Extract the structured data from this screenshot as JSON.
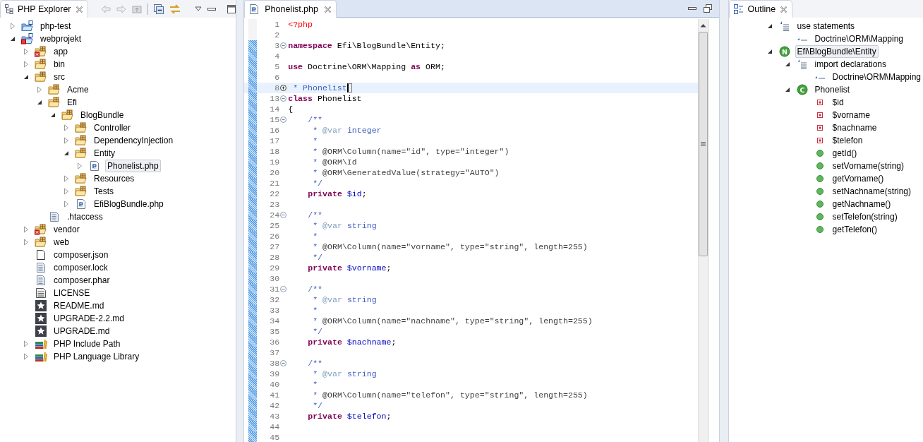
{
  "explorer": {
    "title": "PHP Explorer",
    "tree": [
      {
        "label": "php-test",
        "kind": "project",
        "expanded": false,
        "selected": false
      },
      {
        "label": "webprojekt",
        "kind": "project-error",
        "expanded": true,
        "selected": false,
        "children": [
          {
            "label": "app",
            "kind": "package-error",
            "expanded": false,
            "selected": false
          },
          {
            "label": "bin",
            "kind": "package",
            "expanded": false,
            "selected": false
          },
          {
            "label": "src",
            "kind": "package",
            "expanded": true,
            "selected": false,
            "children": [
              {
                "label": "Acme",
                "kind": "package",
                "expanded": false,
                "selected": false
              },
              {
                "label": "Efi",
                "kind": "package",
                "expanded": true,
                "selected": false,
                "children": [
                  {
                    "label": "BlogBundle",
                    "kind": "package",
                    "expanded": true,
                    "selected": false,
                    "children": [
                      {
                        "label": "Controller",
                        "kind": "package",
                        "expanded": false,
                        "selected": false
                      },
                      {
                        "label": "DependencyInjection",
                        "kind": "package",
                        "expanded": false,
                        "selected": false
                      },
                      {
                        "label": "Entity",
                        "kind": "package",
                        "expanded": true,
                        "selected": false,
                        "children": [
                          {
                            "label": "Phonelist.php",
                            "kind": "php-file",
                            "expanded": false,
                            "selected": true
                          }
                        ]
                      },
                      {
                        "label": "Resources",
                        "kind": "package",
                        "expanded": false,
                        "selected": false
                      },
                      {
                        "label": "Tests",
                        "kind": "package",
                        "expanded": false,
                        "selected": false
                      },
                      {
                        "label": "EfiBlogBundle.php",
                        "kind": "php-file",
                        "expanded": false,
                        "selected": false
                      }
                    ]
                  }
                ]
              },
              {
                "label": ".htaccess",
                "kind": "text-file",
                "selected": false
              }
            ]
          },
          {
            "label": "vendor",
            "kind": "package-error",
            "expanded": false,
            "selected": false
          },
          {
            "label": "web",
            "kind": "package",
            "expanded": false,
            "selected": false
          },
          {
            "label": "composer.json",
            "kind": "file",
            "selected": false
          },
          {
            "label": "composer.lock",
            "kind": "text-file",
            "selected": false
          },
          {
            "label": "composer.phar",
            "kind": "text-file",
            "selected": false
          },
          {
            "label": "LICENSE",
            "kind": "license",
            "selected": false
          },
          {
            "label": "README.md",
            "kind": "markdown",
            "selected": false
          },
          {
            "label": "UPGRADE-2.2.md",
            "kind": "markdown",
            "selected": false
          },
          {
            "label": "UPGRADE.md",
            "kind": "markdown",
            "selected": false
          },
          {
            "label": "PHP Include Path",
            "kind": "library",
            "expanded": false,
            "selected": false
          },
          {
            "label": "PHP Language Library",
            "kind": "library",
            "expanded": false,
            "selected": false
          }
        ]
      }
    ]
  },
  "editor": {
    "tab": "Phonelist.php",
    "lines": [
      {
        "number": "1",
        "changed": false,
        "tokens": [
          {
            "kind": "tag",
            "text": "<?php"
          }
        ]
      },
      {
        "number": "2",
        "changed": false
      },
      {
        "number": "3",
        "changed": true,
        "folded": false,
        "tokens": [
          {
            "kind": "keyword",
            "text": "namespace"
          },
          {
            "kind": "plain",
            "text": " Efi\\BlogBundle\\Entity;"
          }
        ]
      },
      {
        "number": "4",
        "changed": true
      },
      {
        "number": "5",
        "changed": true,
        "tokens": [
          {
            "kind": "keyword",
            "text": "use"
          },
          {
            "kind": "plain",
            "text": " Doctrine\\ORM\\Mapping "
          },
          {
            "kind": "keyword",
            "text": "as"
          },
          {
            "kind": "plain",
            "text": " ORM;"
          }
        ]
      },
      {
        "number": "6",
        "changed": true
      },
      {
        "number": "8",
        "changed": true,
        "folded": true,
        "current": true,
        "tokens": [
          {
            "kind": "doc",
            "text": " * Phonelist"
          }
        ]
      },
      {
        "number": "13",
        "changed": true,
        "folded": false,
        "tokens": [
          {
            "kind": "keyword",
            "text": "class"
          },
          {
            "kind": "plain",
            "text": " Phonelist"
          }
        ]
      },
      {
        "number": "14",
        "changed": true,
        "tokens": [
          {
            "kind": "plain",
            "text": "{"
          }
        ]
      },
      {
        "number": "15",
        "changed": true,
        "folded": false,
        "indented": true,
        "tokens": [
          {
            "kind": "doc",
            "text": "/**"
          }
        ]
      },
      {
        "number": "16",
        "changed": true,
        "indented": true,
        "tokens": [
          {
            "kind": "doc",
            "text": " * "
          },
          {
            "kind": "doctag",
            "text": "@var"
          },
          {
            "kind": "doc",
            "text": " integer"
          }
        ]
      },
      {
        "number": "17",
        "changed": true,
        "indented": true,
        "tokens": [
          {
            "kind": "doc",
            "text": " *"
          }
        ]
      },
      {
        "number": "18",
        "changed": true,
        "indented": true,
        "tokens": [
          {
            "kind": "doc",
            "text": " * "
          },
          {
            "kind": "annotation",
            "text": "@ORM\\Column(name=\"id\", type=\"integer\")"
          }
        ]
      },
      {
        "number": "19",
        "changed": true,
        "indented": true,
        "tokens": [
          {
            "kind": "doc",
            "text": " * "
          },
          {
            "kind": "annotation",
            "text": "@ORM\\Id"
          }
        ]
      },
      {
        "number": "20",
        "changed": true,
        "indented": true,
        "tokens": [
          {
            "kind": "doc",
            "text": " * "
          },
          {
            "kind": "annotation",
            "text": "@ORM\\GeneratedValue(strategy=\"AUTO\")"
          }
        ]
      },
      {
        "number": "21",
        "changed": true,
        "indented": true,
        "tokens": [
          {
            "kind": "doc",
            "text": " */"
          }
        ]
      },
      {
        "number": "22",
        "changed": true,
        "indented": true,
        "tokens": [
          {
            "kind": "keyword",
            "text": "private"
          },
          {
            "kind": "variable",
            "text": " $id"
          },
          {
            "kind": "plain",
            "text": ";"
          }
        ]
      },
      {
        "number": "23",
        "changed": true
      },
      {
        "number": "24",
        "changed": true,
        "folded": false,
        "indented": true,
        "tokens": [
          {
            "kind": "doc",
            "text": "/**"
          }
        ]
      },
      {
        "number": "25",
        "changed": true,
        "indented": true,
        "tokens": [
          {
            "kind": "doc",
            "text": " * "
          },
          {
            "kind": "doctag",
            "text": "@var"
          },
          {
            "kind": "doc",
            "text": " string"
          }
        ]
      },
      {
        "number": "26",
        "changed": true,
        "indented": true,
        "tokens": [
          {
            "kind": "doc",
            "text": " *"
          }
        ]
      },
      {
        "number": "27",
        "changed": true,
        "indented": true,
        "tokens": [
          {
            "kind": "doc",
            "text": " * "
          },
          {
            "kind": "annotation",
            "text": "@ORM\\Column(name=\"vorname\", type=\"string\", length=255)"
          }
        ]
      },
      {
        "number": "28",
        "changed": true,
        "indented": true,
        "tokens": [
          {
            "kind": "doc",
            "text": " */"
          }
        ]
      },
      {
        "number": "29",
        "changed": true,
        "indented": true,
        "tokens": [
          {
            "kind": "keyword",
            "text": "private"
          },
          {
            "kind": "variable",
            "text": " $vorname"
          },
          {
            "kind": "plain",
            "text": ";"
          }
        ]
      },
      {
        "number": "30",
        "changed": true
      },
      {
        "number": "31",
        "changed": true,
        "folded": false,
        "indented": true,
        "tokens": [
          {
            "kind": "doc",
            "text": "/**"
          }
        ]
      },
      {
        "number": "32",
        "changed": true,
        "indented": true,
        "tokens": [
          {
            "kind": "doc",
            "text": " * "
          },
          {
            "kind": "doctag",
            "text": "@var"
          },
          {
            "kind": "doc",
            "text": " string"
          }
        ]
      },
      {
        "number": "33",
        "changed": true,
        "indented": true,
        "tokens": [
          {
            "kind": "doc",
            "text": " *"
          }
        ]
      },
      {
        "number": "34",
        "changed": true,
        "indented": true,
        "tokens": [
          {
            "kind": "doc",
            "text": " * "
          },
          {
            "kind": "annotation",
            "text": "@ORM\\Column(name=\"nachname\", type=\"string\", length=255)"
          }
        ]
      },
      {
        "number": "35",
        "changed": true,
        "indented": true,
        "tokens": [
          {
            "kind": "doc",
            "text": " */"
          }
        ]
      },
      {
        "number": "36",
        "changed": true,
        "indented": true,
        "tokens": [
          {
            "kind": "keyword",
            "text": "private"
          },
          {
            "kind": "variable",
            "text": " $nachname"
          },
          {
            "kind": "plain",
            "text": ";"
          }
        ]
      },
      {
        "number": "37",
        "changed": true
      },
      {
        "number": "38",
        "changed": true,
        "folded": false,
        "indented": true,
        "tokens": [
          {
            "kind": "doc",
            "text": "/**"
          }
        ]
      },
      {
        "number": "39",
        "changed": true,
        "indented": true,
        "tokens": [
          {
            "kind": "doc",
            "text": " * "
          },
          {
            "kind": "doctag",
            "text": "@var"
          },
          {
            "kind": "doc",
            "text": " string"
          }
        ]
      },
      {
        "number": "40",
        "changed": true,
        "indented": true,
        "tokens": [
          {
            "kind": "doc",
            "text": " *"
          }
        ]
      },
      {
        "number": "41",
        "changed": true,
        "indented": true,
        "tokens": [
          {
            "kind": "doc",
            "text": " * "
          },
          {
            "kind": "annotation",
            "text": "@ORM\\Column(name=\"telefon\", type=\"string\", length=255)"
          }
        ]
      },
      {
        "number": "42",
        "changed": true,
        "indented": true,
        "tokens": [
          {
            "kind": "doc",
            "text": " */"
          }
        ]
      },
      {
        "number": "43",
        "changed": true,
        "indented": true,
        "tokens": [
          {
            "kind": "keyword",
            "text": "private"
          },
          {
            "kind": "variable",
            "text": " $telefon"
          },
          {
            "kind": "plain",
            "text": ";"
          }
        ]
      },
      {
        "number": "44",
        "changed": true
      },
      {
        "number": "45",
        "changed": true
      }
    ]
  },
  "outline": {
    "title": "Outline",
    "tree": [
      {
        "label": "use statements",
        "kind": "use-group",
        "expanded": true,
        "selected": false,
        "children": [
          {
            "label": "Doctrine\\ORM\\Mapping",
            "kind": "import",
            "selected": false
          }
        ]
      },
      {
        "label": "Efi\\BlogBundle\\Entity",
        "kind": "namespace",
        "badge": "N",
        "expanded": true,
        "selected": true,
        "children": [
          {
            "label": "import declarations",
            "kind": "use-group",
            "expanded": true,
            "selected": false,
            "children": [
              {
                "label": "Doctrine\\ORM\\Mapping",
                "kind": "import",
                "selected": false
              }
            ]
          },
          {
            "label": "Phonelist",
            "kind": "class",
            "badge": "C",
            "expanded": true,
            "selected": false,
            "children": [
              {
                "label": "$id",
                "kind": "field",
                "selected": false
              },
              {
                "label": "$vorname",
                "kind": "field",
                "selected": false
              },
              {
                "label": "$nachname",
                "kind": "field",
                "selected": false
              },
              {
                "label": "$telefon",
                "kind": "field",
                "selected": false
              },
              {
                "label": "getId()",
                "kind": "method",
                "selected": false
              },
              {
                "label": "setVorname(string)",
                "kind": "method",
                "selected": false
              },
              {
                "label": "getVorname()",
                "kind": "method",
                "selected": false
              },
              {
                "label": "setNachname(string)",
                "kind": "method",
                "selected": false
              },
              {
                "label": "getNachname()",
                "kind": "method",
                "selected": false
              },
              {
                "label": "setTelefon(string)",
                "kind": "method",
                "selected": false
              },
              {
                "label": "getTelefon()",
                "kind": "method",
                "selected": false
              }
            ]
          }
        ]
      }
    ]
  }
}
